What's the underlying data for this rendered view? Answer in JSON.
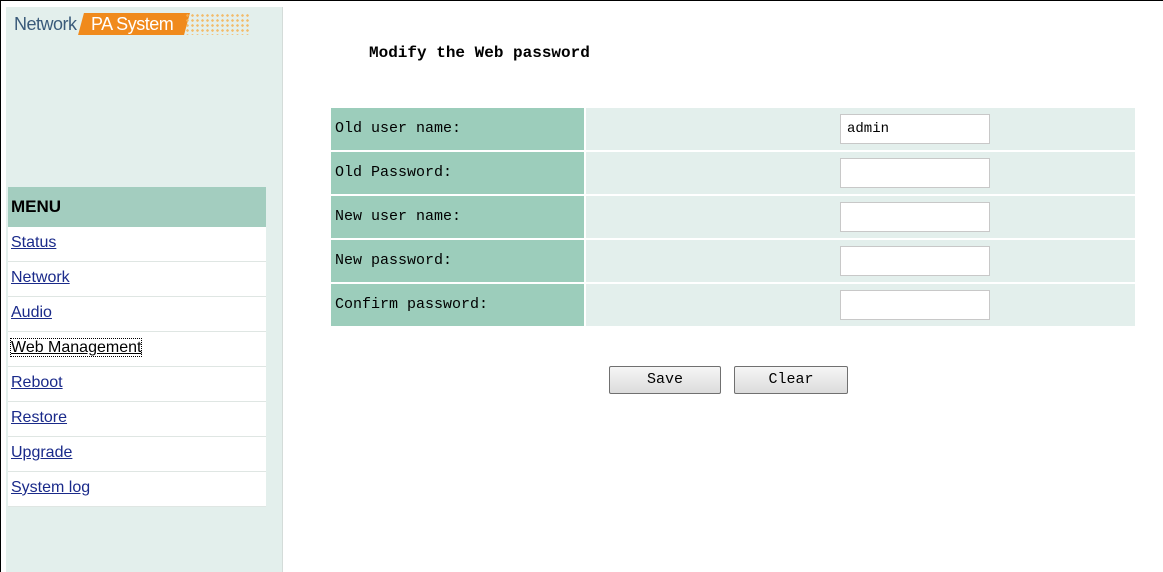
{
  "logo": {
    "network_text": "Network",
    "pa_text": "PA System"
  },
  "menu": {
    "header": "MENU",
    "items": [
      {
        "label": "Status"
      },
      {
        "label": "Network"
      },
      {
        "label": "Audio"
      },
      {
        "label": "Web Management",
        "active": true
      },
      {
        "label": "Reboot"
      },
      {
        "label": "Restore"
      },
      {
        "label": "Upgrade"
      },
      {
        "label": "System log"
      }
    ]
  },
  "page": {
    "title": "Modify the Web password"
  },
  "form": {
    "fields": [
      {
        "label": "Old user name:",
        "value": "admin"
      },
      {
        "label": "Old Password:",
        "value": ""
      },
      {
        "label": "New user name:",
        "value": ""
      },
      {
        "label": "New password:",
        "value": ""
      },
      {
        "label": "Confirm password:",
        "value": ""
      }
    ],
    "save_label": "Save",
    "clear_label": "Clear"
  },
  "colors": {
    "sidebar_bg": "#e3efec",
    "menu_header_bg": "#a3cdbf",
    "label_cell_bg": "#9ccdbb",
    "input_cell_bg": "#e3efec",
    "logo_accent": "#f08a1c",
    "link_color": "#1a2a8a"
  }
}
